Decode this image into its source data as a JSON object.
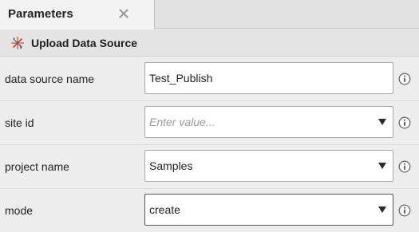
{
  "tab": {
    "label": "Parameters",
    "close_icon": "close-icon"
  },
  "section": {
    "title": "Upload Data Source",
    "icon": "data-source-icon"
  },
  "rows": [
    {
      "label": "data source name",
      "value": "Test_Publish",
      "type": "text"
    },
    {
      "label": "site id",
      "placeholder": "Enter value...",
      "type": "dropdown"
    },
    {
      "label": "project name",
      "value": "Samples",
      "type": "dropdown"
    },
    {
      "label": "mode",
      "value": "create",
      "type": "dropdown"
    }
  ],
  "colors": {
    "background": "#ececec",
    "field_border": "#a9a9a9",
    "placeholder": "#9a9a9a"
  }
}
